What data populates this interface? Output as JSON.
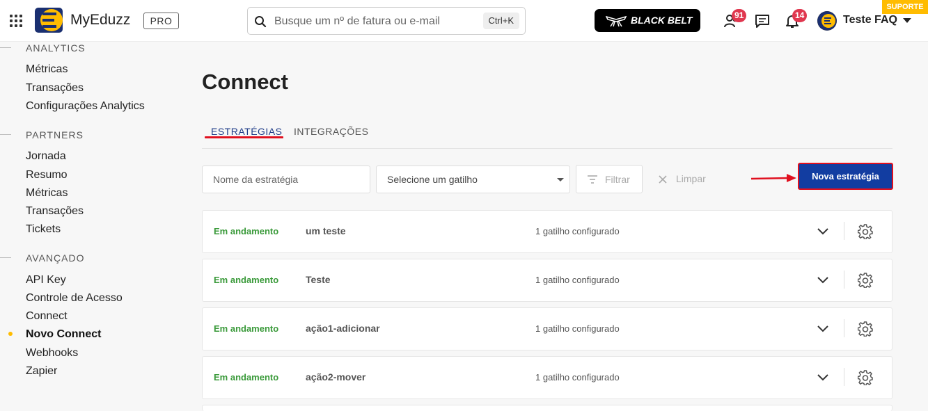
{
  "header": {
    "brand": "MyEduzz",
    "plan": "PRO",
    "search_placeholder": "Busque um nº de fatura ou e-mail",
    "search_shortcut": "Ctrl+K",
    "blackbelt_label": "BLACK BELT",
    "partners_badge": "91",
    "notifications_badge": "14",
    "user_name": "Teste FAQ",
    "support_label": "SUPORTE",
    "brand_color": "#ffbc00"
  },
  "sidebar": {
    "analytics": {
      "title": "ANALYTICS",
      "items": [
        "Métricas",
        "Transações",
        "Configurações Analytics"
      ]
    },
    "partners": {
      "title": "PARTNERS",
      "items": [
        "Jornada",
        "Resumo",
        "Métricas",
        "Transações",
        "Tickets"
      ]
    },
    "avancado": {
      "title": "AVANÇADO",
      "items": [
        "API Key",
        "Controle de Acesso",
        "Connect",
        "Novo Connect",
        "Webhooks",
        "Zapier"
      ],
      "active": "Novo Connect"
    }
  },
  "main": {
    "title": "Connect",
    "tabs": [
      {
        "label": "ESTRATÉGIAS",
        "active": true
      },
      {
        "label": "INTEGRAÇÕES",
        "active": false
      }
    ],
    "filters": {
      "name_placeholder": "Nome da estratégia",
      "trigger_select": "Selecione um gatilho",
      "filter_label": "Filtrar",
      "clear_label": "Limpar",
      "new_button": "Nova estratégia"
    },
    "strategies": [
      {
        "status": "Em andamento",
        "name": "um teste",
        "triggers": "1 gatilho configurado"
      },
      {
        "status": "Em andamento",
        "name": "Teste",
        "triggers": "1 gatilho configurado"
      },
      {
        "status": "Em andamento",
        "name": "ação1-adicionar",
        "triggers": "1 gatilho configurado"
      },
      {
        "status": "Em andamento",
        "name": "ação2-mover",
        "triggers": "1 gatilho configurado"
      }
    ],
    "status_color": "#3a9a3a",
    "primary_color": "#123da1",
    "highlight_color": "#e0101f"
  }
}
